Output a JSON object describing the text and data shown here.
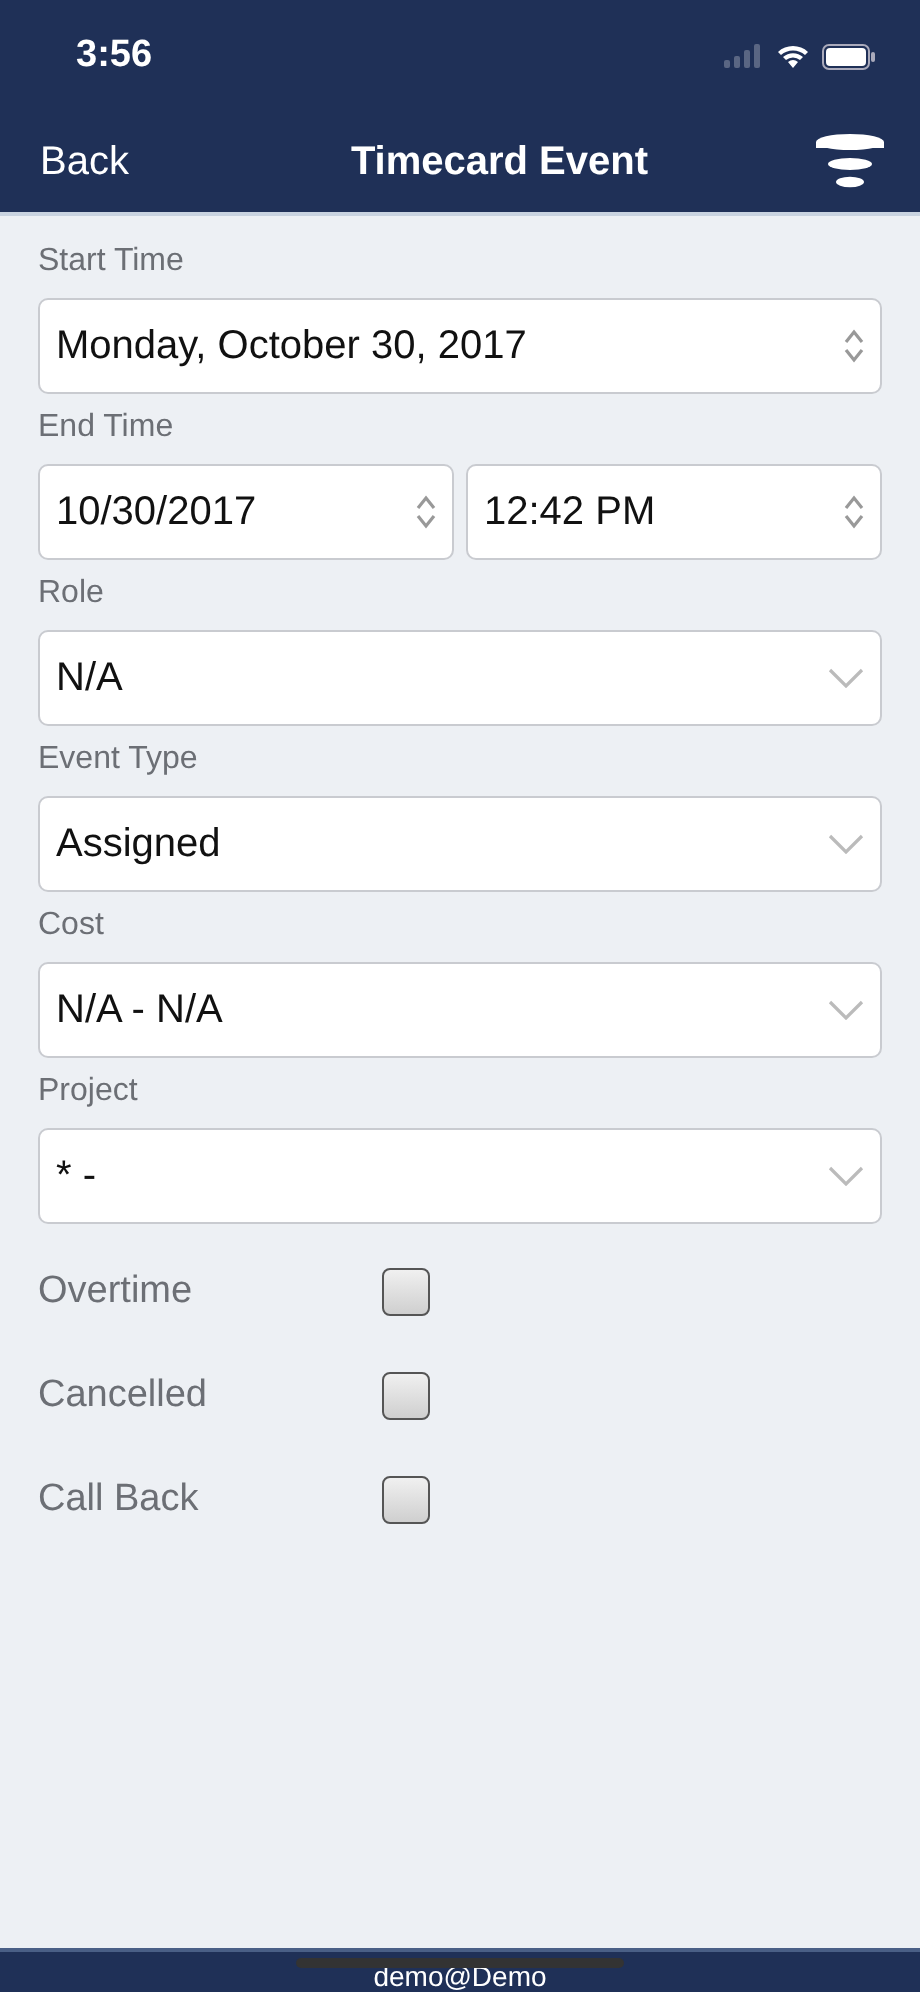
{
  "status_bar": {
    "time": "3:56"
  },
  "nav": {
    "back": "Back",
    "title": "Timecard Event"
  },
  "fields": [
    {
      "label": "Start Time",
      "inputs": [
        {
          "value": "Monday, October 30, 2017",
          "kind": "stepper"
        }
      ]
    },
    {
      "label": "End Time",
      "inputs": [
        {
          "value": "10/30/2017",
          "kind": "stepper"
        },
        {
          "value": "12:42 PM",
          "kind": "stepper"
        }
      ]
    },
    {
      "label": "Role",
      "inputs": [
        {
          "value": "N/A",
          "kind": "dropdown"
        }
      ]
    },
    {
      "label": "Event Type",
      "inputs": [
        {
          "value": "Assigned",
          "kind": "dropdown"
        }
      ]
    },
    {
      "label": "Cost",
      "inputs": [
        {
          "value": "N/A - N/A",
          "kind": "dropdown"
        }
      ]
    },
    {
      "label": "Project",
      "inputs": [
        {
          "value": "* -",
          "kind": "dropdown"
        }
      ]
    }
  ],
  "checkboxes": [
    {
      "label": "Overtime",
      "checked": false
    },
    {
      "label": "Cancelled",
      "checked": false
    },
    {
      "label": "Call Back",
      "checked": false
    }
  ],
  "footer": {
    "user": "demo@Demo"
  }
}
